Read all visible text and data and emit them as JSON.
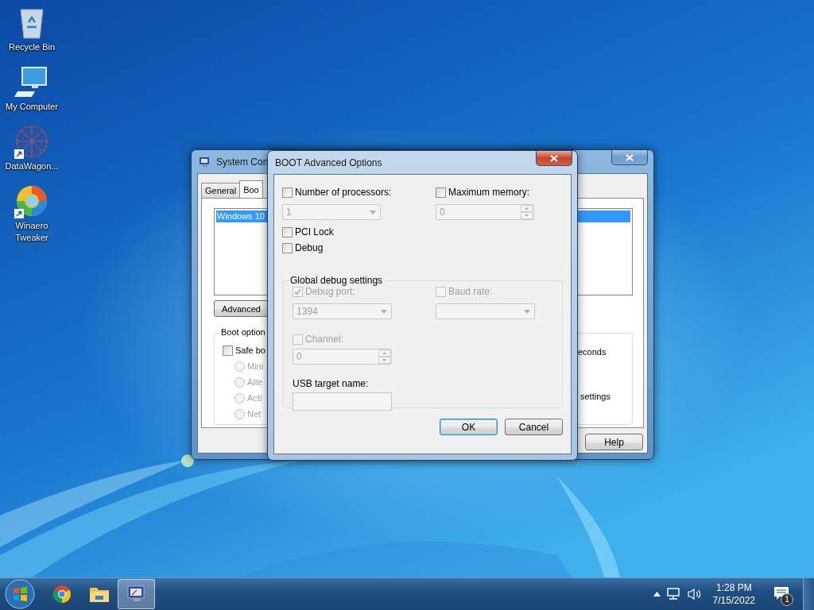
{
  "desktop_icons": [
    {
      "label": "Recycle Bin",
      "kind": "recycle",
      "shortcut": false
    },
    {
      "label": "My Computer",
      "kind": "computer",
      "shortcut": false
    },
    {
      "label": "DataWagon...",
      "kind": "datawagon",
      "shortcut": true
    },
    {
      "label": "Winaero Tweaker",
      "kind": "winaero",
      "shortcut": true
    }
  ],
  "back_window": {
    "title": "System Con",
    "tabs": [
      {
        "label": "General",
        "selected": false
      },
      {
        "label": "Boo",
        "selected": true
      }
    ],
    "boot_list": [
      {
        "label": "Windows 10",
        "selected": true
      }
    ],
    "advanced_button": "Advanced",
    "group_label": "Boot option",
    "safe_boot": {
      "label": "Safe bo",
      "checked": false
    },
    "safe_boot_modes": [
      {
        "label": "Mini",
        "selected": false
      },
      {
        "label": "Alte",
        "selected": false
      },
      {
        "label": "Acti",
        "selected": false
      },
      {
        "label": "Net",
        "selected": false
      }
    ],
    "timeout_fragment": "econds",
    "settings_fragment": "settings",
    "help_button": "Help"
  },
  "dialog": {
    "title": "BOOT Advanced Options",
    "processors": {
      "label": "Number of processors:",
      "checked": false,
      "value": "1"
    },
    "memory": {
      "label": "Maximum memory:",
      "checked": false,
      "value": "0"
    },
    "options": [
      {
        "label": "PCI Lock",
        "checked": false
      },
      {
        "label": "Debug",
        "checked": false
      }
    ],
    "debug_group": {
      "title": "Global debug settings",
      "debug_port": {
        "label": "Debug port:",
        "checked": true,
        "disabled": true,
        "value": "1394"
      },
      "baud_rate": {
        "label": "Baud rate:",
        "checked": false,
        "disabled": true
      },
      "channel": {
        "label": "Channel:",
        "checked": false,
        "disabled": true,
        "value": "0"
      },
      "usb_label": "USB target name:"
    },
    "buttons": [
      {
        "label": "OK",
        "focused": true
      },
      {
        "label": "Cancel",
        "focused": false
      }
    ]
  },
  "taskbar": {
    "pinned": [
      {
        "kind": "chrome",
        "active": false
      },
      {
        "kind": "explorer",
        "active": false
      },
      {
        "kind": "msconfig",
        "active": true
      }
    ],
    "clock": {
      "time": "1:28 PM",
      "date": "7/15/2022"
    },
    "notification_count": "1"
  }
}
